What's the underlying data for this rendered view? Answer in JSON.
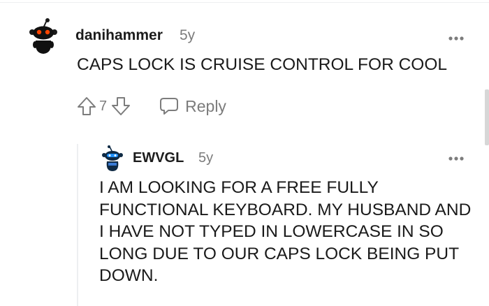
{
  "comments": [
    {
      "username": "danihammer",
      "age": "5y",
      "body": "CAPS LOCK IS CRUISE CONTROL FOR COOL",
      "score": "7",
      "reply_label": "Reply",
      "avatar_icon": "snoo-black-red-eyes-avatar",
      "more_icon": "more-options-icon"
    },
    {
      "username": "EWVGL",
      "age": "5y",
      "body": "I AM LOOKING FOR A FREE FULLY FUNCTIONAL KEYBOARD. MY HUSBAND AND I HAVE NOT TYPED IN LOWERCASE IN SO LONG DUE TO OUR CAPS LOCK BEING PUT DOWN.",
      "avatar_icon": "snoo-navy-avatar",
      "more_icon": "more-options-icon"
    }
  ],
  "colors": {
    "text": "#1a1a1a",
    "meta": "#7c7c7c",
    "thread_line": "#edeff1",
    "scrollbar": "#d7d7d7"
  }
}
